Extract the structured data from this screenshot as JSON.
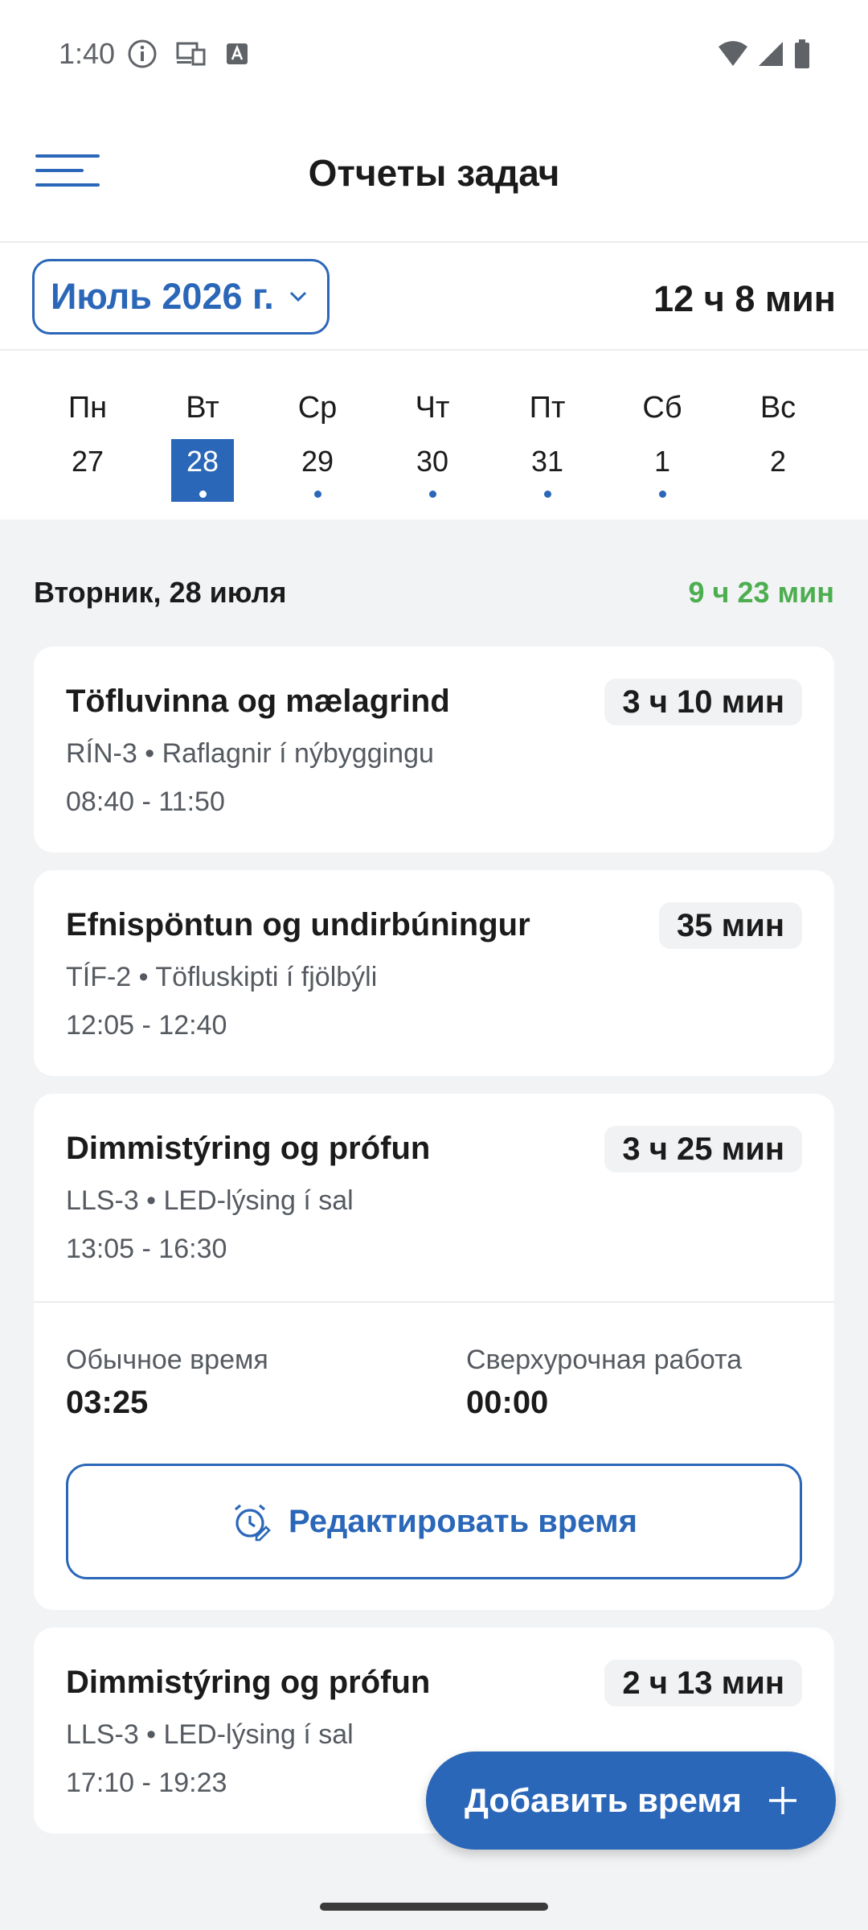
{
  "status": {
    "time": "1:40"
  },
  "header": {
    "title": "Отчеты задач"
  },
  "month": {
    "label": "Июль 2026 г.",
    "total": "12 ч 8 мин"
  },
  "week": [
    {
      "name": "Пн",
      "num": "27",
      "selected": false,
      "dot": false
    },
    {
      "name": "Вт",
      "num": "28",
      "selected": true,
      "dot": true
    },
    {
      "name": "Ср",
      "num": "29",
      "selected": false,
      "dot": true
    },
    {
      "name": "Чт",
      "num": "30",
      "selected": false,
      "dot": true
    },
    {
      "name": "Пт",
      "num": "31",
      "selected": false,
      "dot": true
    },
    {
      "name": "Сб",
      "num": "1",
      "selected": false,
      "dot": true
    },
    {
      "name": "Вс",
      "num": "2",
      "selected": false,
      "dot": false
    }
  ],
  "day": {
    "title": "Вторник, 28 июля",
    "total": "9 ч 23 мин"
  },
  "tasks": [
    {
      "title": "Töfluvinna og mælagrind",
      "duration": "3 ч 10 мин",
      "sub": "RÍN-3 • Raflagnir í nýbyggingu",
      "time": "08:40 - 11:50"
    },
    {
      "title": "Efnispöntun og undirbúningur",
      "duration": "35 мин",
      "sub": "TÍF-2 • Töfluskipti í fjölbýli",
      "time": "12:05 - 12:40"
    },
    {
      "title": "Dimmistýring og prófun",
      "duration": "3 ч 25 мин",
      "sub": "LLS-3 • LED-lýsing í sal",
      "time": "13:05 - 16:30",
      "regular_label": "Обычное время",
      "regular_value": "03:25",
      "overtime_label": "Сверхурочная работа",
      "overtime_value": "00:00",
      "edit_label": "Редактировать время"
    },
    {
      "title": "Dimmistýring og prófun",
      "duration": "2 ч 13 мин",
      "sub": "LLS-3 • LED-lýsing í sal",
      "time": "17:10 - 19:23"
    }
  ],
  "fab": {
    "label": "Добавить время"
  },
  "colors": {
    "accent": "#2b67b8",
    "positive": "#4cae4f"
  }
}
